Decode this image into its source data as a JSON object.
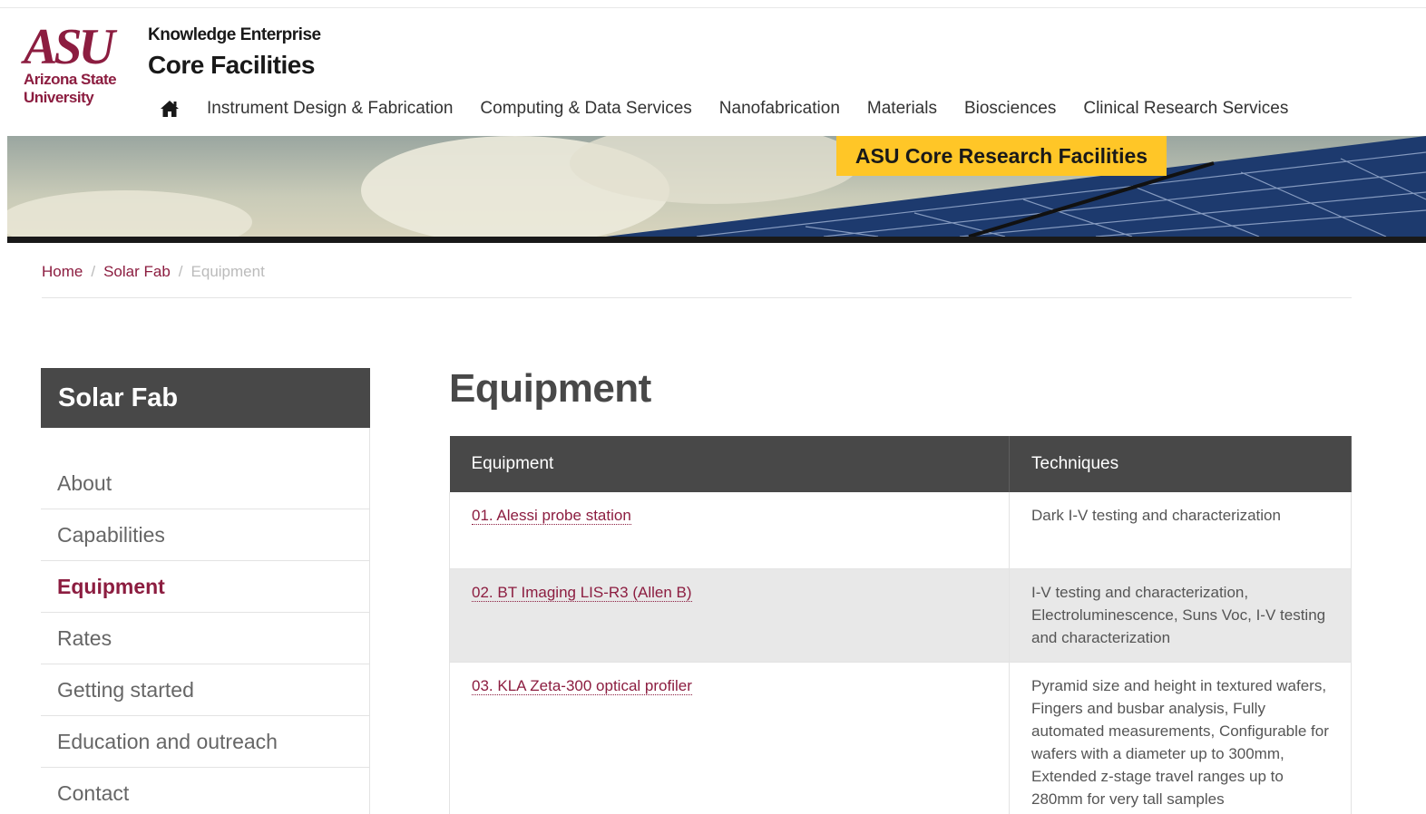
{
  "header": {
    "logo": {
      "mark": "ASU",
      "line1": "Arizona State",
      "line2": "University"
    },
    "kicker": "Knowledge Enterprise",
    "title": "Core Facilities"
  },
  "nav": {
    "home_icon": "home-icon",
    "items": [
      "Instrument Design & Fabrication",
      "Computing & Data Services",
      "Nanofabrication",
      "Materials",
      "Biosciences",
      "Clinical Research Services"
    ]
  },
  "hero": {
    "tag": "ASU Core Research Facilities"
  },
  "breadcrumb": {
    "home": "Home",
    "section": "Solar Fab",
    "current": "Equipment"
  },
  "sidebar": {
    "title": "Solar Fab",
    "items": [
      "About",
      "Capabilities",
      "Equipment",
      "Rates",
      "Getting started",
      "Education and outreach",
      "Contact"
    ],
    "active_index": 2
  },
  "main": {
    "title": "Equipment",
    "table": {
      "headers": [
        "Equipment",
        "Techniques"
      ],
      "rows": [
        {
          "equipment": "01. Alessi probe station",
          "techniques": "Dark I-V testing and characterization"
        },
        {
          "equipment": "02. BT Imaging LIS-R3 (Allen B)",
          "techniques": "I-V testing and characterization, Electroluminescence, Suns Voc, I-V testing and characterization"
        },
        {
          "equipment": "03. KLA Zeta-300 optical profiler",
          "techniques": "Pyramid size and height in textured wafers, Fingers and busbar analysis, Fully automated measurements, Configurable for wafers with a diameter up to 300mm, Extended z-stage travel ranges up to 280mm for very tall samples"
        }
      ]
    }
  },
  "colors": {
    "maroon": "#8c1d40",
    "gold": "#ffc627",
    "dark": "#484848"
  }
}
